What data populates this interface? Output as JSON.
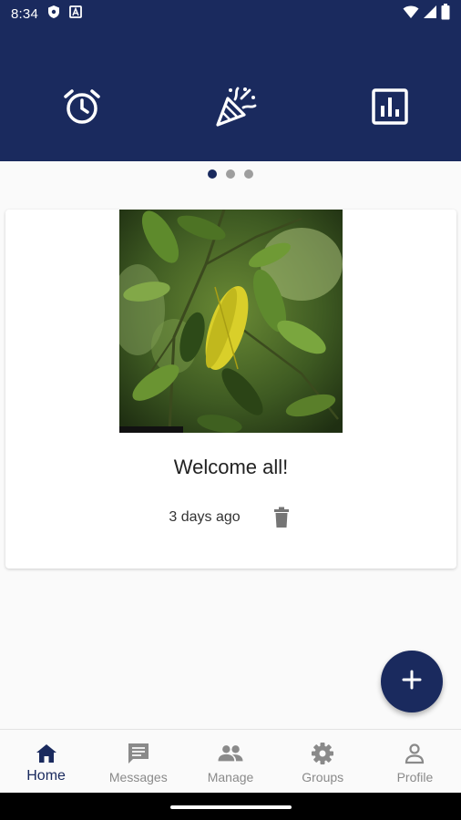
{
  "status_bar": {
    "time": "8:34",
    "left_icons": [
      "shield-icon",
      "a-icon"
    ],
    "right_icons": [
      "wifi-icon",
      "signal-icon",
      "battery-icon"
    ]
  },
  "header": {
    "icons": [
      "alarm-clock-icon",
      "party-popper-icon",
      "bar-chart-icon"
    ],
    "background": "#1a2a5e"
  },
  "pager": {
    "pages": 3,
    "active_index": 0
  },
  "post": {
    "image": "green-leaves-with-yellow-leaf",
    "title": "Welcome all!",
    "time_ago": "3 days ago",
    "delete_icon": "trash-icon"
  },
  "fab": {
    "icon": "plus-icon"
  },
  "nav": {
    "items": [
      {
        "label": "Home",
        "icon": "home-icon",
        "active": true
      },
      {
        "label": "Messages",
        "icon": "message-icon",
        "active": false
      },
      {
        "label": "Manage",
        "icon": "people-icon",
        "active": false
      },
      {
        "label": "Groups",
        "icon": "gear-icon",
        "active": false
      },
      {
        "label": "Profile",
        "icon": "person-icon",
        "active": false
      }
    ]
  },
  "colors": {
    "primary": "#1a2a5e",
    "inactive": "#8a8a8a"
  }
}
